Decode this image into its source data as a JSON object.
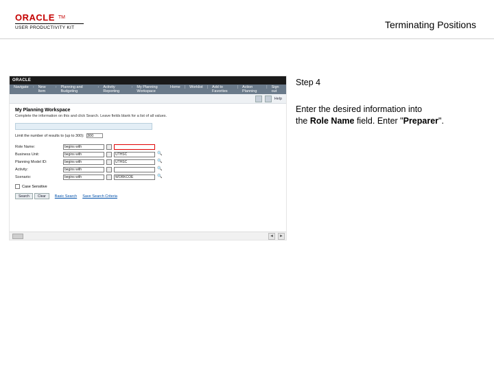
{
  "header": {
    "brand": "ORACLE",
    "tm": "TM",
    "product_line": "USER PRODUCTIVITY KIT",
    "title": "Terminating Positions"
  },
  "instruction": {
    "step_label": "Step 4",
    "line1": "Enter the desired information into ",
    "line2a": "the ",
    "field_name": "Role Name",
    "line2b": " field. Enter \"",
    "value": "Preparer",
    "line2c": "\"."
  },
  "screenshot": {
    "brand": "ORACLE",
    "menu_left": [
      "Navigate",
      "New Item",
      "Planning and Budgeting",
      "Activity Reporting",
      "My Planning Workspace"
    ],
    "menu_right": [
      "Home",
      "Worklist",
      "Add to Favorites",
      "Action Planning",
      "Sign out"
    ],
    "toolbar_text": "Help",
    "workspace_title": "My Planning Workspace",
    "workspace_sub": "Complete the information on this and click Search. Leave fields blank for a list of all values.",
    "list_text": "Limit the number of results to (up to 300):",
    "list_value": "300",
    "rows": [
      {
        "label": "Role Name:",
        "op": "begins with",
        "val": ""
      },
      {
        "label": "Business Unit:",
        "op": "begins with",
        "val": "UTHSC"
      },
      {
        "label": "Planning Model ID:",
        "op": "begins with",
        "val": "UTHSC"
      },
      {
        "label": "Activity:",
        "op": "begins with",
        "val": ""
      },
      {
        "label": "Scenario:",
        "op": "begins with",
        "val": "WORKCOE"
      }
    ],
    "checkbox_label": "Case Sensitive",
    "btn_search": "Search",
    "btn_clear": "Clear",
    "link1": "Basic Search",
    "link2": "Save Search Criteria"
  }
}
